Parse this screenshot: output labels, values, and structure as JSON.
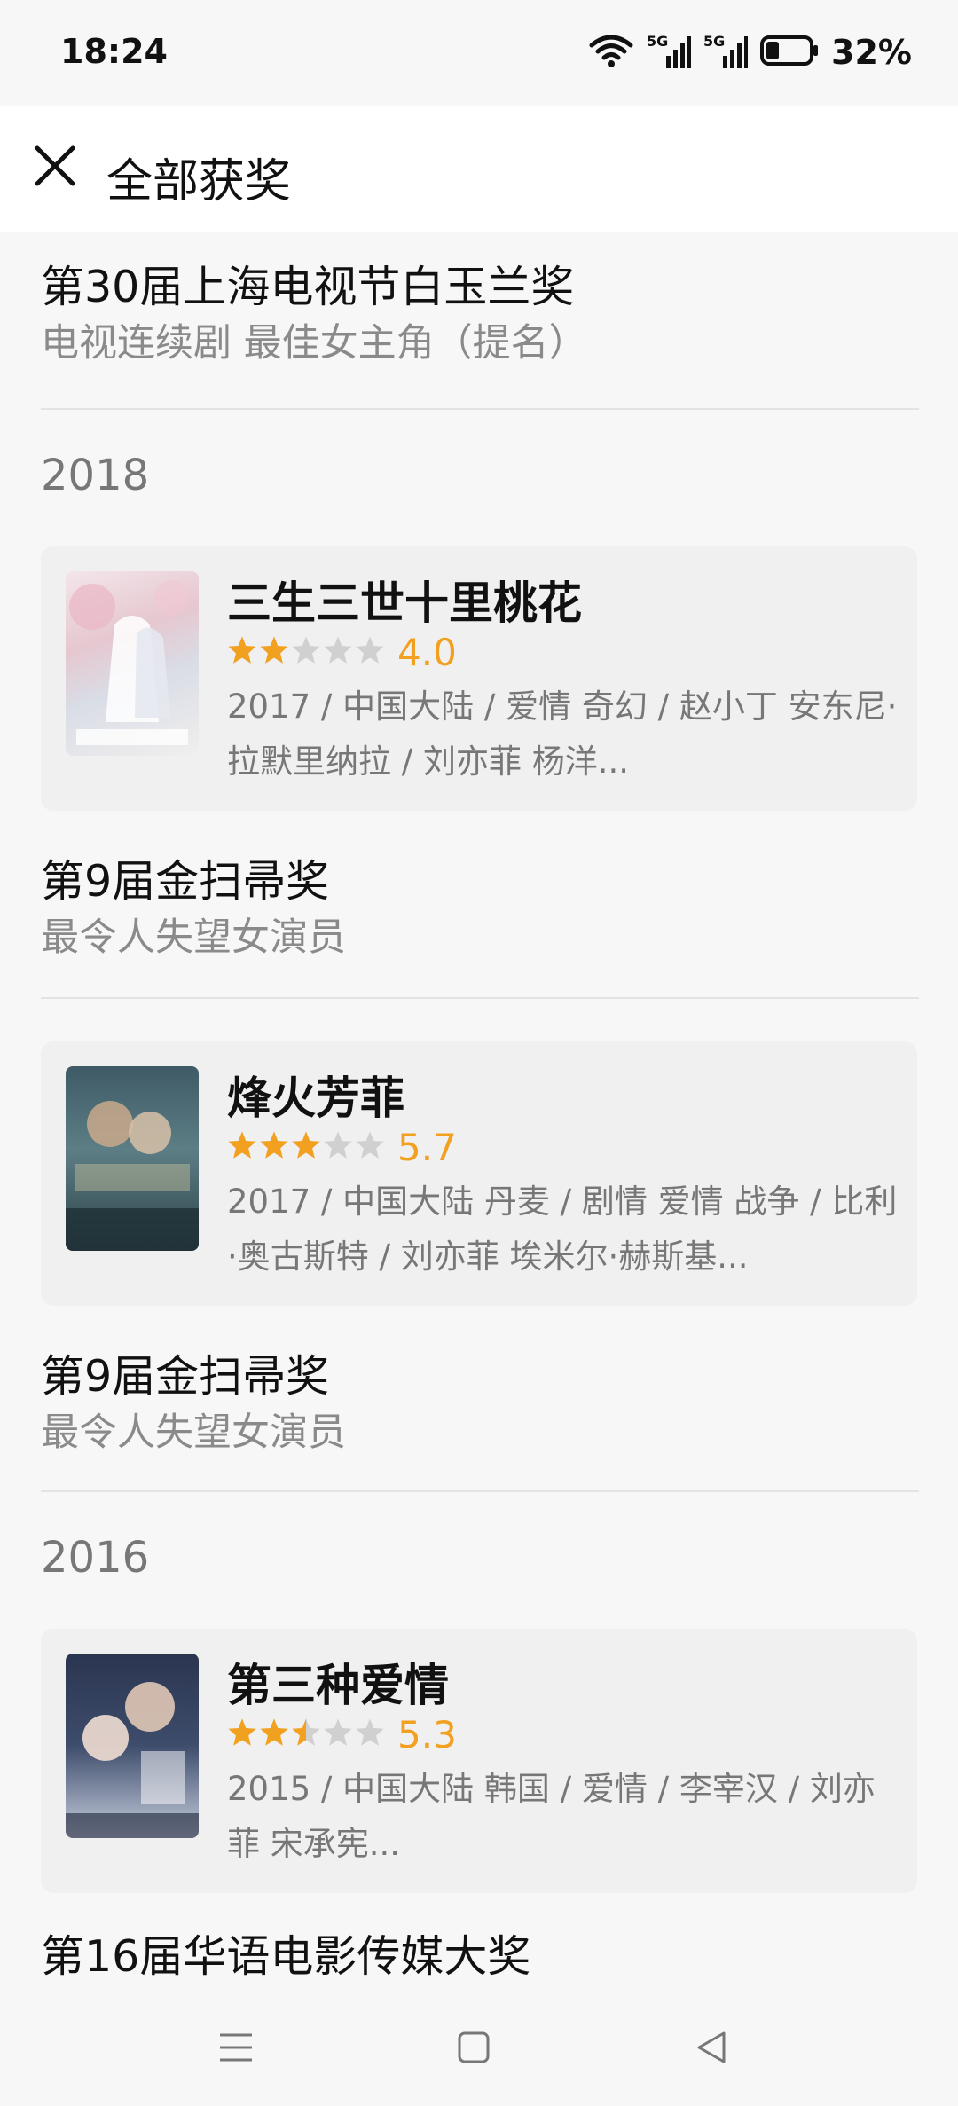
{
  "status_bar": {
    "time": "18:24",
    "network_1": "5G",
    "network_2": "5G",
    "battery": "32%",
    "icons": [
      "wifi-icon",
      "signal-5g-icon",
      "signal-5g-icon",
      "battery-icon"
    ]
  },
  "header": {
    "title": "全部获奖",
    "close_icon": "close-icon"
  },
  "colors": {
    "star_filled": "#f1a020",
    "star_empty": "#d0d0d0",
    "rating_text": "#f1a020",
    "muted_text": "#8a8a8a",
    "card_bg": "#f0f0f0"
  },
  "awards": [
    {
      "name": "第30届上海电视节白玉兰奖",
      "category": "电视连续剧 最佳女主角（提名）"
    },
    {
      "name": "第9届金扫帚奖",
      "category": "最令人失望女演员"
    },
    {
      "name": "第9届金扫帚奖",
      "category": "最令人失望女演员"
    },
    {
      "name": "第16届华语电影传媒大奖",
      "category": ""
    }
  ],
  "years": [
    "2018",
    "2016"
  ],
  "movies": [
    {
      "title": "三生三世十里桃花",
      "rating": "4.0",
      "stars": 2,
      "info": "2017 / 中国大陆 / 爱情 奇幻 / 赵小丁 安东尼·拉默里纳拉 / 刘亦菲 杨洋..."
    },
    {
      "title": "烽火芳菲",
      "rating": "5.7",
      "stars": 3,
      "info": "2017 / 中国大陆 丹麦 / 剧情 爱情 战争 / 比利·奥古斯特 / 刘亦菲 埃米尔·赫斯基..."
    },
    {
      "title": "第三种爱情",
      "rating": "5.3",
      "stars": 2.5,
      "info": "2015 / 中国大陆 韩国 / 爱情 / 李宰汉 / 刘亦菲 宋承宪..."
    }
  ],
  "bottom_nav": {
    "icons": [
      "menu-icon",
      "home-square-icon",
      "back-triangle-icon"
    ]
  }
}
